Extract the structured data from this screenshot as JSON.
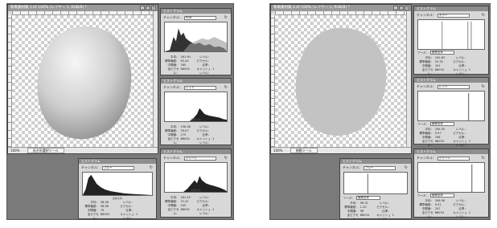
{
  "left": {
    "doc": {
      "title": "和風素材集 1.tif 100% (レイヤー 1, RGB/8) *",
      "zoom": "100%",
      "tool": "長方形選択ツール",
      "buttons": {
        "minimize": "_",
        "maximize": "□",
        "close": "×"
      }
    },
    "panels": [
      {
        "title": "ヒストグラム",
        "channel_label": "チャンネル：",
        "channel": "RGB",
        "stats": [
          [
            "平均：",
            "161.90",
            "レベル：",
            ""
          ],
          [
            "標準偏差：",
            "63.40",
            "ピクセル：",
            ""
          ],
          [
            "中間値：",
            "185",
            "比率：",
            ""
          ],
          [
            "全ピクセル：",
            "86034",
            "キャッシュレベル：",
            "1"
          ]
        ]
      },
      {
        "title": "ヒストグラム",
        "channel_label": "チャンネル：",
        "channel": "レッド",
        "source_label": "画像全体",
        "stats": [
          [
            "平均：",
            "196.38",
            "レベル：",
            ""
          ],
          [
            "標準偏差：",
            "39.07",
            "ピクセル：",
            ""
          ],
          [
            "中間値：",
            "175",
            "比率：",
            ""
          ],
          [
            "全ピクセル：",
            "86034",
            "キャッシュレベル：",
            "1"
          ]
        ]
      },
      {
        "title": "ヒストグラム",
        "channel_label": "チャンネル：",
        "channel": "グリーン",
        "source_label": "画像全体",
        "stats": [
          [
            "平均：",
            "161.43",
            "レベル：",
            ""
          ],
          [
            "標準偏差：",
            "37.47",
            "ピクセル：",
            ""
          ],
          [
            "中間値：",
            "205",
            "比率：",
            ""
          ],
          [
            "全ピクセル：",
            "86034",
            "キャッシュレベル：",
            "1"
          ]
        ]
      },
      {
        "title": "ヒストグラム",
        "channel_label": "チャンネル：",
        "channel": "ブルー",
        "source_label": "画像全体",
        "stats": [
          [
            "平均：",
            "98.36",
            "レベル：",
            ""
          ],
          [
            "標準偏差：",
            "36.58",
            "ピクセル：",
            ""
          ],
          [
            "中間値：",
            "79",
            "比率：",
            ""
          ],
          [
            "全ピクセル：",
            "86034",
            "キャッシュレベル：",
            "1"
          ]
        ]
      }
    ]
  },
  "right": {
    "doc": {
      "title": "和風素材集 2.tif 100% (レイヤー 1, RGB/8) *",
      "zoom": "100%",
      "tool": "移動ツール",
      "buttons": {
        "minimize": "_",
        "maximize": "□",
        "close": "×"
      }
    },
    "panels": [
      {
        "title": "ヒストグラム",
        "channel_label": "チャンネル：",
        "channel": "カラー",
        "source_label": "ソース：",
        "source": "画像全体",
        "stats": [
          [
            "平均：",
            "192.83",
            "レベル：",
            ""
          ],
          [
            "標準偏差：",
            "53.35",
            "ピクセル：",
            ""
          ],
          [
            "中間値：",
            "191",
            "比率：",
            ""
          ],
          [
            "全ピクセル：",
            "86034",
            "キャッシュレベル：",
            "1"
          ]
        ]
      },
      {
        "title": "ヒストグラム",
        "channel_label": "チャンネル：",
        "channel": "レッド",
        "source_label": "ソース：",
        "source": "画像全体",
        "stats": [
          [
            "平均：",
            "195.55",
            "レベル：",
            ""
          ],
          [
            "標準偏差：",
            "0.97",
            "ピクセル：",
            ""
          ],
          [
            "中間値：",
            "196",
            "比率：",
            ""
          ],
          [
            "全ピクセル：",
            "86034",
            "キャッシュレベル：",
            "1"
          ]
        ]
      },
      {
        "title": "ヒストグラム",
        "channel_label": "チャンネル：",
        "channel": "グリーン",
        "source_label": "ソース：",
        "source": "画像全体",
        "stats": [
          [
            "平均：",
            "206.96",
            "レベル：",
            ""
          ],
          [
            "標準偏差：",
            "0.51",
            "ピクセル：",
            ""
          ],
          [
            "中間値：",
            "207",
            "比率：",
            ""
          ],
          [
            "全ピクセル：",
            "86034",
            "キャッシュレベル：",
            "1"
          ]
        ]
      },
      {
        "title": "ヒストグラム",
        "channel_label": "チャンネル：",
        "channel": "ブルー",
        "source_label": "ソース：",
        "source": "画像全体",
        "stats": [
          [
            "平均：",
            "96.31",
            "レベル：",
            ""
          ],
          [
            "標準偏差：",
            "1.20",
            "ピクセル：",
            ""
          ],
          [
            "中間値：",
            "96",
            "比率：",
            ""
          ],
          [
            "全ピクセル：",
            "86034",
            "キャッシュレベル：",
            "1"
          ]
        ]
      }
    ]
  }
}
